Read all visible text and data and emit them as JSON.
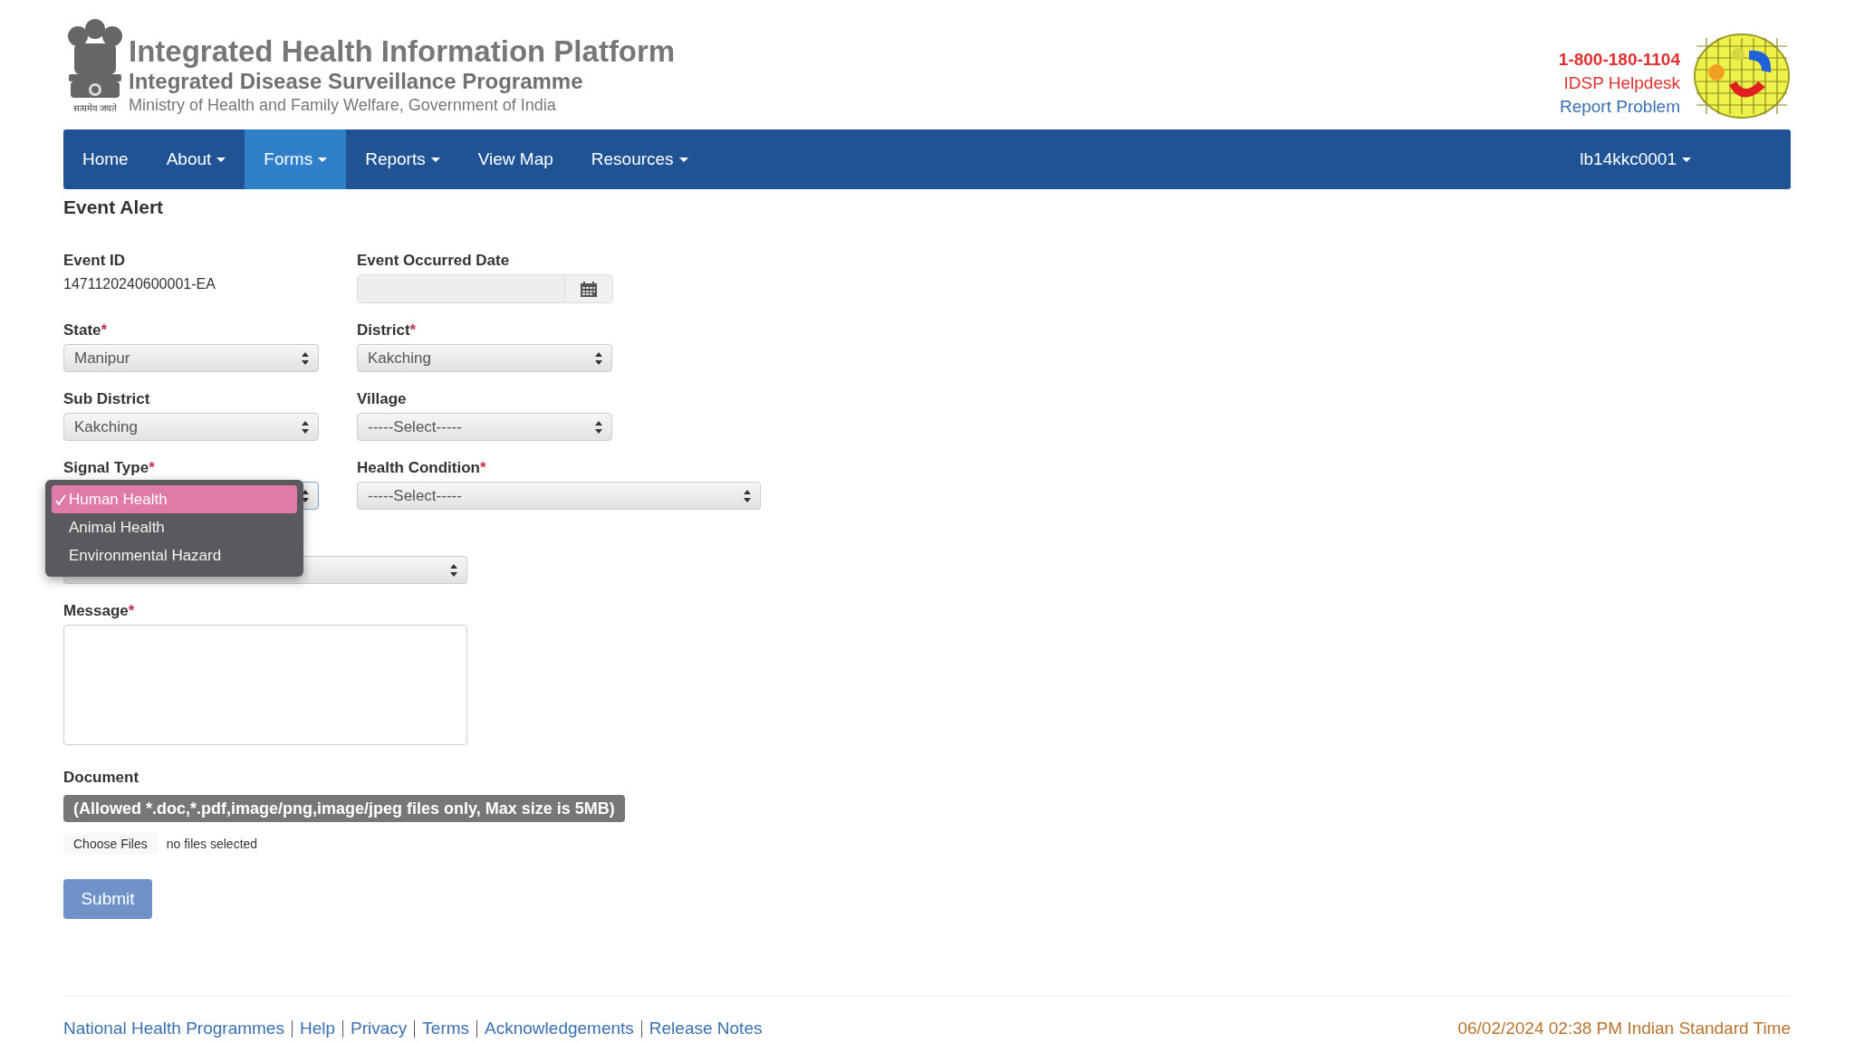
{
  "header": {
    "motto": "सत्यमेव जयते",
    "title": "Integrated Health Information Platform",
    "subtitle": "Integrated Disease Surveillance Programme",
    "ministry": "Ministry of Health and Family Welfare, Government of India",
    "helpline": "1-800-180-1104",
    "helpdesk": "IDSP Helpdesk",
    "report_link": "Report Problem"
  },
  "nav": {
    "items": [
      {
        "label": "Home",
        "caret": false,
        "selected": false
      },
      {
        "label": "About",
        "caret": true,
        "selected": false
      },
      {
        "label": "Forms",
        "caret": true,
        "selected": true
      },
      {
        "label": "Reports",
        "caret": true,
        "selected": false
      },
      {
        "label": "View Map",
        "caret": false,
        "selected": false
      },
      {
        "label": "Resources",
        "caret": true,
        "selected": false
      }
    ],
    "user": {
      "label": "lb14kkc0001",
      "caret": true
    }
  },
  "form": {
    "title": "Event Alert",
    "rows": [
      [
        {
          "kind": "static",
          "label": "Event ID",
          "value": "1471120240600001-EA"
        },
        {
          "kind": "date",
          "label": "Event Occurred Date"
        }
      ],
      [
        {
          "kind": "select",
          "label": "State",
          "required_mark": "*",
          "value": "Manipur"
        },
        {
          "kind": "select",
          "label": "District",
          "required_mark": "*",
          "value": "Kakching"
        }
      ],
      [
        {
          "kind": "select",
          "label": "Sub District",
          "value": "Kakching"
        },
        {
          "kind": "select",
          "label": "Village",
          "value": "-----Select-----"
        }
      ],
      [
        {
          "kind": "select",
          "label": "Signal Type",
          "required_mark": "*",
          "dropdown": [
            {
              "label": "Human Health",
              "selected": true
            },
            {
              "label": "Animal Health",
              "selected": false
            },
            {
              "label": "Environmental Hazard",
              "selected": false
            }
          ]
        },
        {
          "kind": "select",
          "label": "Health Condition",
          "required_mark": "*",
          "wide": true,
          "value": "-----Select-----"
        }
      ],
      [
        {
          "kind": "select",
          "wide": true
        }
      ],
      [
        {
          "kind": "textarea",
          "label": "Message",
          "required_mark": "*",
          "wide": true
        }
      ],
      [
        {
          "kind": "file",
          "label": "Document",
          "notice": "(Allowed *.doc,*.pdf,image/png,image/jpeg files only, Max size is 5MB)",
          "button": "Choose Files",
          "status": "no files selected"
        }
      ]
    ],
    "submit": {
      "label": "Submit",
      "disabled": true
    }
  },
  "footer": {
    "links": [
      "National Health Programmes",
      "Help",
      "Privacy",
      "Terms",
      "Acknowledgements",
      "Release Notes"
    ],
    "timestamp": "06/02/2024 02:38 PM Indian Standard Time"
  }
}
